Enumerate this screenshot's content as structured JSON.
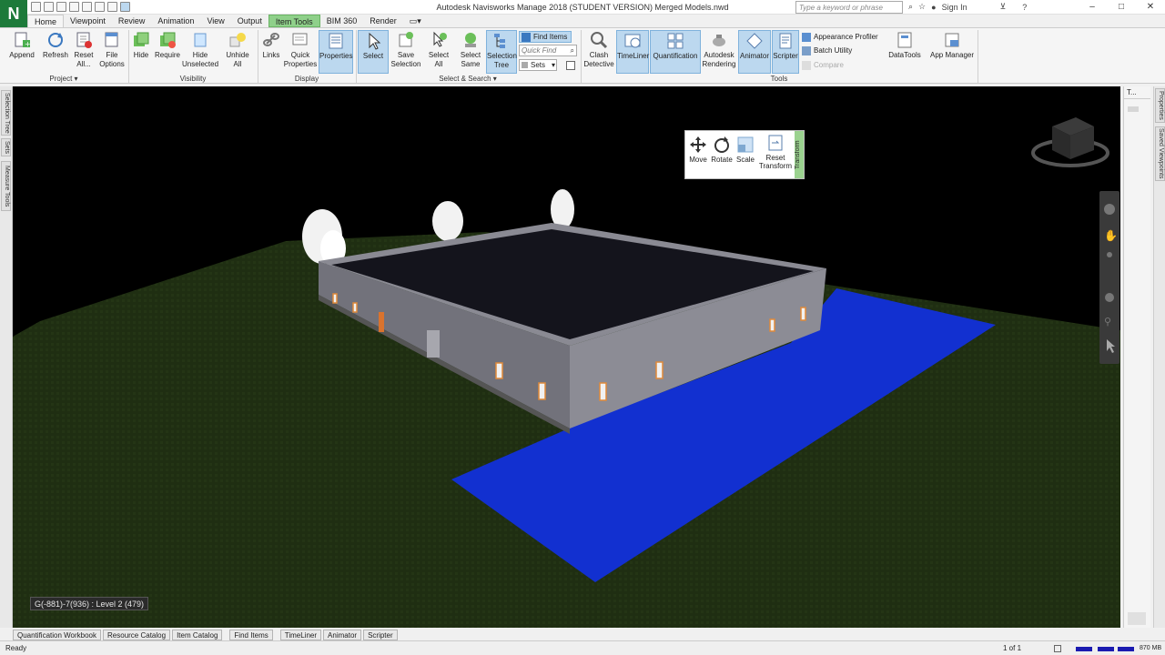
{
  "window": {
    "title": "Autodesk Navisworks Manage 2018 (STUDENT VERSION)    Merged Models.nwd",
    "app_letter": "N",
    "search_placeholder": "Type a keyword or phrase",
    "sign_in": "Sign In",
    "controls": [
      "–",
      "□",
      "✕"
    ]
  },
  "tabs": [
    {
      "label": "Home",
      "state": "active"
    },
    {
      "label": "Viewpoint",
      "state": ""
    },
    {
      "label": "Review",
      "state": ""
    },
    {
      "label": "Animation",
      "state": ""
    },
    {
      "label": "View",
      "state": ""
    },
    {
      "label": "Output",
      "state": ""
    },
    {
      "label": "Item Tools",
      "state": "context"
    },
    {
      "label": "BIM 360",
      "state": ""
    },
    {
      "label": "Render",
      "state": ""
    }
  ],
  "ribbon": {
    "append": "Append",
    "refresh": "Refresh",
    "reset_all": "Reset All...",
    "file_options": "File Options",
    "hide": "Hide",
    "require": "Require",
    "hide_unselected": "Hide Unselected",
    "unhide_all": "Unhide All",
    "links": "Links",
    "quick_properties": "Quick Properties",
    "properties": "Properties",
    "select": "Select",
    "save_selection": "Save Selection",
    "select_all": "Select All",
    "select_same": "Select Same",
    "selection_tree": "Selection Tree",
    "find_items": "Find Items",
    "quick_find_placeholder": "Quick Find",
    "sets": "Sets",
    "clash_detective": "Clash Detective",
    "timeliner": "TimeLiner",
    "quantification": "Quantification",
    "autodesk_rendering": "Autodesk Rendering",
    "animator": "Animator",
    "scripter": "Scripter",
    "appearance_profiler": "Appearance Profiler",
    "batch_utility": "Batch Utility",
    "compare": "Compare",
    "datatools": "DataTools",
    "app_manager": "App Manager",
    "groups": {
      "project": "Project ▾",
      "visibility": "Visibility",
      "display": "Display",
      "select_search": "Select & Search ▾",
      "tools": "Tools"
    }
  },
  "left_panel_tabs": [
    "Selection Tree",
    "Sets",
    "Measure Tools"
  ],
  "right_panel_tabs": [
    "Properties",
    "Saved Viewpoints"
  ],
  "right_panel_header": "T...",
  "gizmo": {
    "move": "Move",
    "rotate": "Rotate",
    "scale": "Scale",
    "reset_transform": "Reset Transform",
    "side_label": "Transform"
  },
  "viewport": {
    "coordinate_readout": "G(-881)-7(936) : Level 2 (479)"
  },
  "bottom_tabs": [
    "Quantification Workbook",
    "Resource Catalog",
    "Item Catalog",
    "Find Items",
    "TimeLiner",
    "Animator",
    "Scripter"
  ],
  "status": {
    "text": "Ready",
    "page": "1 of 1",
    "memory": "870 MB"
  },
  "colors": {
    "water": "#1230d0",
    "ground": "#1f2e12",
    "wall": "#7e7e86",
    "roof": "#14141c",
    "context_tab": "#8fd08a",
    "highlight": "#bcd8ef"
  }
}
